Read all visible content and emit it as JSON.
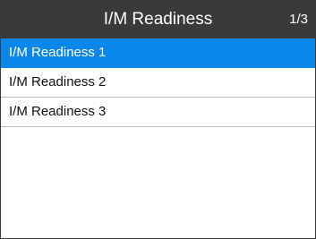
{
  "header": {
    "title": "I/M Readiness",
    "page_indicator": "1/3"
  },
  "list": {
    "items": [
      {
        "label": "I/M Readiness 1",
        "selected": true
      },
      {
        "label": "I/M Readiness 2",
        "selected": false
      },
      {
        "label": "I/M Readiness 3",
        "selected": false
      }
    ]
  },
  "colors": {
    "header_bg": "#3a3a3a",
    "selection": "#0b87ea",
    "divider": "#bcbcbc"
  }
}
